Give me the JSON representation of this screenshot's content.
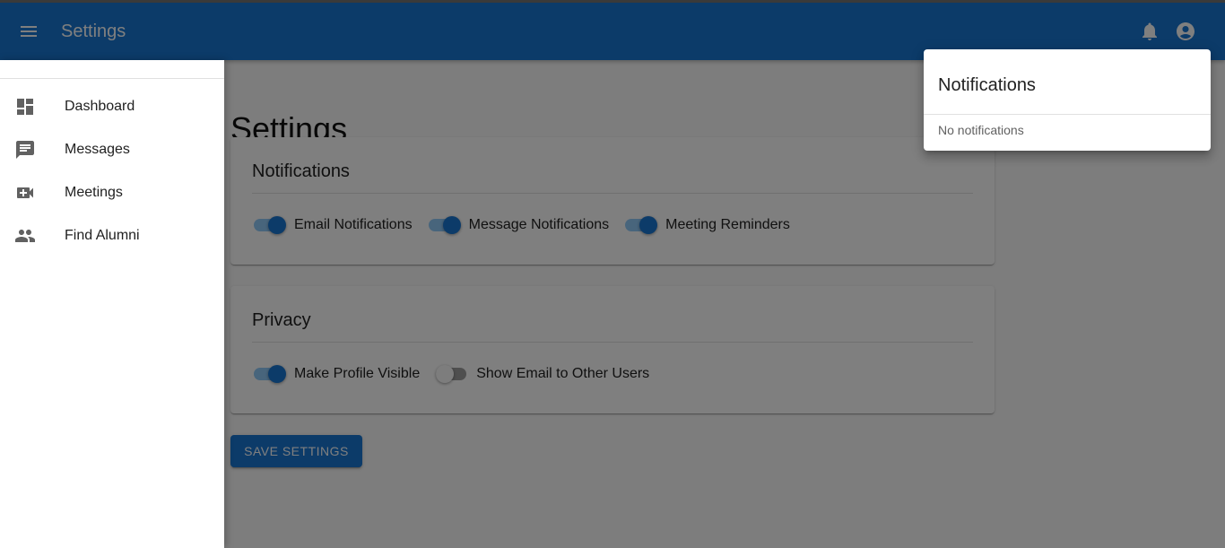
{
  "appbar": {
    "title": "Settings",
    "menu_icon": "menu-icon",
    "notifications_icon": "bell-icon",
    "account_icon": "account-circle-icon",
    "color": "#1976d2"
  },
  "page": {
    "title": "Settings"
  },
  "notifications_card": {
    "title": "Notifications",
    "switches": [
      {
        "label": "Email Notifications",
        "checked": true
      },
      {
        "label": "Message Notifications",
        "checked": true
      },
      {
        "label": "Meeting Reminders",
        "checked": true
      }
    ]
  },
  "privacy_card": {
    "title": "Privacy",
    "switches": [
      {
        "label": "Make Profile Visible",
        "checked": true
      },
      {
        "label": "Show Email to Other Users",
        "checked": false
      }
    ]
  },
  "save_button": {
    "label": "SAVE SETTINGS"
  },
  "drawer": {
    "items": [
      {
        "label": "Dashboard",
        "icon": "dashboard-icon"
      },
      {
        "label": "Messages",
        "icon": "chat-icon"
      },
      {
        "label": "Meetings",
        "icon": "video-call-icon"
      },
      {
        "label": "Find Alumni",
        "icon": "people-icon"
      }
    ]
  },
  "notifications_popover": {
    "title": "Notifications",
    "empty_text": "No notifications"
  }
}
